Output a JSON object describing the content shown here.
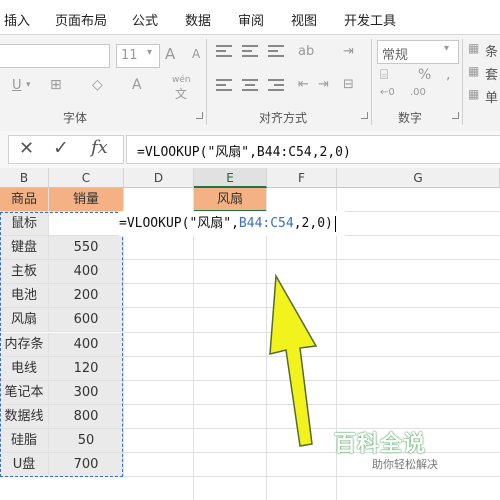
{
  "ribbon_tabs": [
    "插入",
    "页面布局",
    "公式",
    "数据",
    "审阅",
    "视图",
    "开发工具"
  ],
  "ribbon": {
    "font_size": "11",
    "font_group_label": "字体",
    "align_group_label": "对齐方式",
    "number_group_label": "数字",
    "number_format": "常规",
    "number_symbols": {
      "currency": "%",
      "comma": ","
    },
    "right_labels": [
      "条",
      "套",
      "单"
    ],
    "font_buttons": {
      "underline": "U",
      "wen": "wén",
      "wen_char": "文",
      "grow": "A",
      "shrink": "A"
    }
  },
  "formula_bar": {
    "cancel_icon": "✕",
    "enter_icon": "✓",
    "fx_icon": "fx",
    "formula": "=VLOOKUP(\"风扇\",B44:C54,2,0)"
  },
  "columns": [
    "B",
    "C",
    "D",
    "E",
    "F",
    "G"
  ],
  "table": {
    "headers": {
      "b": "商品",
      "c": "销量"
    },
    "rows": [
      {
        "b": "鼠标",
        "c": ""
      },
      {
        "b": "键盘",
        "c": "550"
      },
      {
        "b": "主板",
        "c": "400"
      },
      {
        "b": "电池",
        "c": "200"
      },
      {
        "b": "风扇",
        "c": "600"
      },
      {
        "b": "内存条",
        "c": "400"
      },
      {
        "b": "电线",
        "c": "120"
      },
      {
        "b": "笔记本",
        "c": "300"
      },
      {
        "b": "数据线",
        "c": "800"
      },
      {
        "b": "硅脂",
        "c": "50"
      },
      {
        "b": "U盘",
        "c": "700"
      }
    ]
  },
  "lookup_header": "风扇",
  "edit_cell": {
    "pre": "=VLOOKUP(\"风扇\",",
    "ref": "B44:C54",
    "post": ",2,0)"
  },
  "watermark": {
    "title": "百科全说",
    "subtitle": "助你轻松解决"
  },
  "colors": {
    "header_fill": "#f4b183",
    "arrow": "#f2f21d",
    "accent": "#217346",
    "ref_blue": "#3a6fc4"
  }
}
